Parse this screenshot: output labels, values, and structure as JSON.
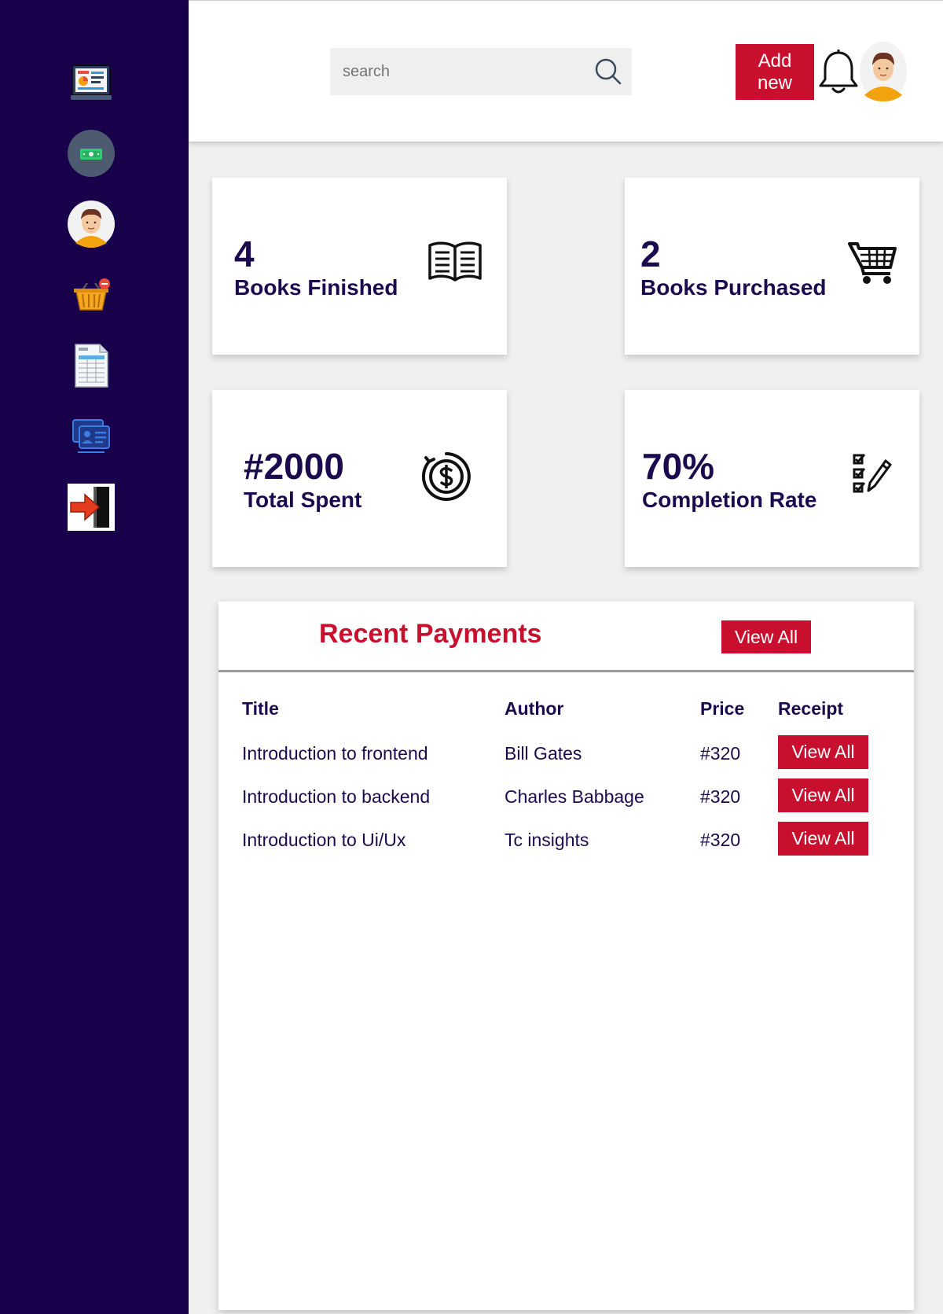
{
  "sidebar": {
    "items": [
      {
        "icon": "dashboard-icon"
      },
      {
        "icon": "money-icon"
      },
      {
        "icon": "profile-avatar-icon"
      },
      {
        "icon": "basket-icon"
      },
      {
        "icon": "spreadsheet-icon"
      },
      {
        "icon": "id-card-icon"
      },
      {
        "icon": "logout-icon"
      }
    ]
  },
  "header": {
    "search_placeholder": "search",
    "add_new_label": "Add new",
    "add_new_line1": "Add",
    "add_new_line2": "new"
  },
  "stats": [
    {
      "value": "4",
      "label": "Books Finished",
      "icon": "open-book-icon"
    },
    {
      "value": "2",
      "label": "Books Purchased",
      "icon": "cart-icon"
    },
    {
      "value": "#2000",
      "label": "Total Spent",
      "icon": "dollar-coin-icon"
    },
    {
      "value": "70%",
      "label": "Completion Rate",
      "icon": "checklist-icon"
    }
  ],
  "payments": {
    "title": "Recent Payments",
    "view_all_label": "View All",
    "columns": [
      "Title",
      "Author",
      "Price",
      "Receipt"
    ],
    "rows": [
      {
        "title": "Introduction to frontend",
        "author": "Bill Gates",
        "price": "#320",
        "receipt_label": "View All"
      },
      {
        "title": "Introduction to backend",
        "author": "Charles Babbage",
        "price": "#320",
        "receipt_label": "View All"
      },
      {
        "title": "Introduction to Ui/Ux",
        "author": "Tc insights",
        "price": "#320",
        "receipt_label": "View All"
      }
    ]
  },
  "colors": {
    "sidebar_bg": "#18004a",
    "accent": "#c8102e",
    "text_dark": "#1b0a4e",
    "page_bg": "#f0f0f0"
  }
}
